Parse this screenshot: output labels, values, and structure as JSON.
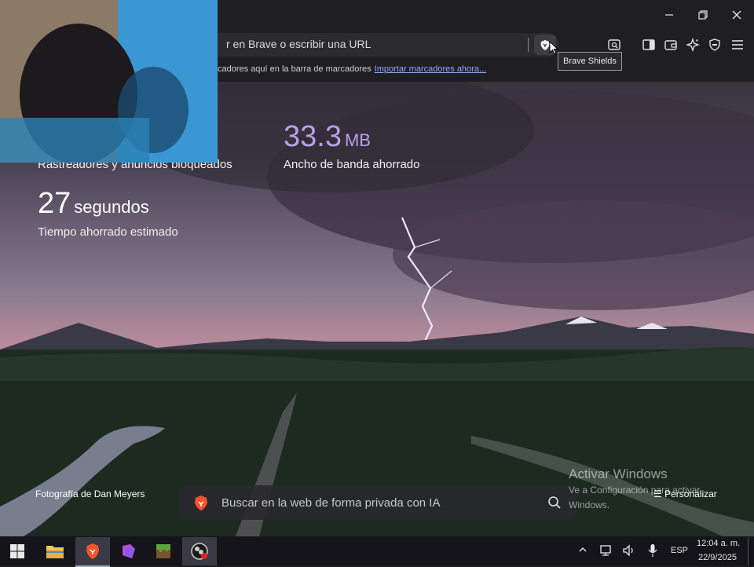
{
  "window": {
    "minimize_label": "–",
    "maximize_label": "□",
    "close_label": "✕"
  },
  "toolbar": {
    "url_placeholder": "r en Brave o escribir una URL",
    "tooltip": "Brave Shields",
    "icons": [
      "search-tabs-icon",
      "sidebar-icon",
      "wallet-icon",
      "leo-ai-icon",
      "vpn-shield-icon",
      "menu-icon"
    ]
  },
  "bookmarks_bar": {
    "message": "cadores aquí en la barra de marcadores",
    "import_link": "Importar marcadores ahora..."
  },
  "stats": {
    "trackers_label": "Rastreadores y anuncios bloqueados",
    "bandwidth_value": "33.3",
    "bandwidth_unit": "MB",
    "bandwidth_label": "Ancho de banda ahorrado",
    "time_value": "27",
    "time_unit": "segundos",
    "time_label": "Tiempo ahorrado estimado"
  },
  "search": {
    "placeholder": "Buscar en la web de forma privada con IA"
  },
  "photo_credit": "Fotografía de Dan Meyers",
  "personalize_label": "Personalizar",
  "watermark": {
    "title": "Activar Windows",
    "line1": "Ve a Configuración para activar",
    "line2": "Windows."
  },
  "taskbar": {
    "apps": [
      "windows-start",
      "file-explorer",
      "brave-browser",
      "purple-app",
      "minecraft",
      "obs-studio"
    ],
    "language": "ESP",
    "time": "12:04 a. m.",
    "date": "22/9/2025"
  },
  "colors": {
    "accent_purple": "#b7a2e8",
    "stat_text": "#ffffff",
    "link": "#8fa8ff"
  }
}
